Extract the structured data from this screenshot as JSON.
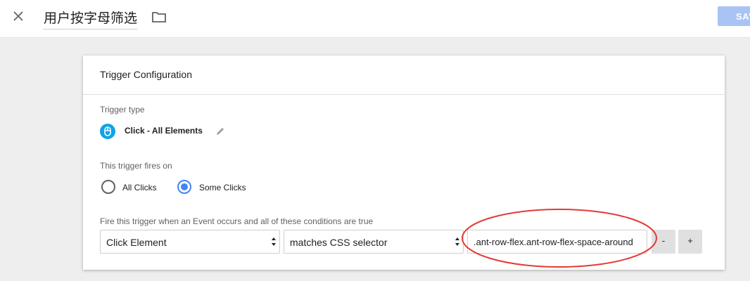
{
  "topbar": {
    "close_icon": "close-icon",
    "title": "用户按字母筛选",
    "folder_icon": "folder-icon",
    "save_label": "SAVE"
  },
  "card": {
    "title": "Trigger Configuration",
    "trigger_type_label": "Trigger type",
    "trigger_type_name": "Click - All Elements",
    "trigger_type_icon": "mouse-icon",
    "edit_icon": "pencil-icon",
    "fires_on_label": "This trigger fires on",
    "radio_all": "All Clicks",
    "radio_some": "Some Clicks",
    "selected_radio": "Some Clicks",
    "conditions_label": "Fire this trigger when an Event occurs and all of these conditions are true",
    "condition": {
      "variable": "Click Element",
      "operator": "matches CSS selector",
      "value": ".ant-row-flex.ant-row-flex-space-around"
    },
    "remove_label": "-",
    "add_label": "+"
  },
  "colors": {
    "accent": "#4285f4",
    "save_disabled": "#a9c4f4",
    "trigger_icon": "#0fa3e8",
    "annotation": "#e53935"
  }
}
